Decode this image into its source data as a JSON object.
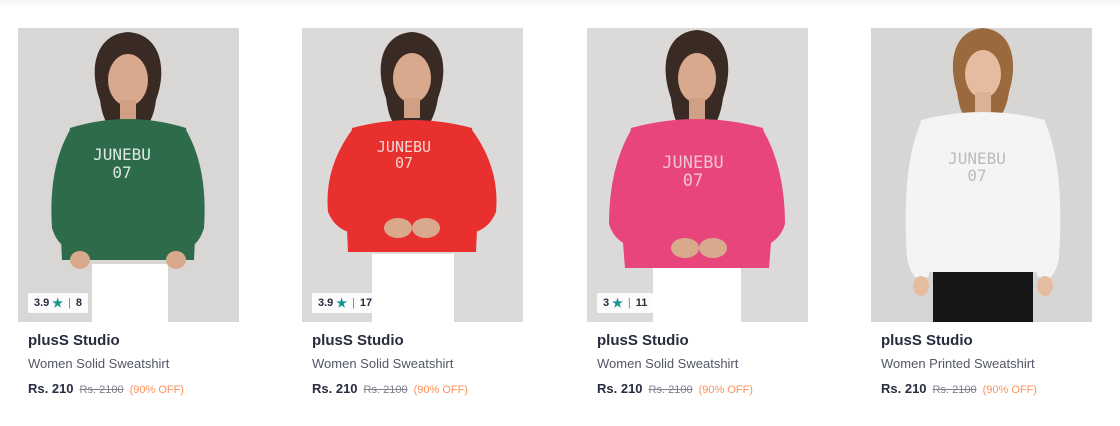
{
  "products": [
    {
      "brand": "plusS Studio",
      "title": "Women Solid Sweatshirt",
      "rating": "3.9",
      "rating_count": "8",
      "price": "Rs. 210",
      "mrp": "Rs. 2100",
      "discount": "(90% OFF)",
      "sweatshirt_color": "#2e6b4a",
      "print_line1": "JUNEBU",
      "print_line2": "07",
      "background": "#d9d7d6"
    },
    {
      "brand": "plusS Studio",
      "title": "Women Solid Sweatshirt",
      "rating": "3.9",
      "rating_count": "17",
      "price": "Rs. 210",
      "mrp": "Rs. 2100",
      "discount": "(90% OFF)",
      "sweatshirt_color": "#e8302f",
      "print_line1": "JUNEBU",
      "print_line2": "07",
      "background": "#dcdad9"
    },
    {
      "brand": "plusS Studio",
      "title": "Women Solid Sweatshirt",
      "rating": "3",
      "rating_count": "11",
      "price": "Rs. 210",
      "mrp": "Rs. 2100",
      "discount": "(90% OFF)",
      "sweatshirt_color": "#e8457d",
      "print_line1": "JUNEBU",
      "print_line2": "07",
      "background": "#dcdad9"
    },
    {
      "brand": "plusS Studio",
      "title": "Women Printed Sweatshirt",
      "rating": null,
      "rating_count": null,
      "price": "Rs. 210",
      "mrp": "Rs. 2100",
      "discount": "(90% OFF)",
      "sweatshirt_color": "#f4f4f4",
      "print_line1": "JUNEBU",
      "print_line2": "07",
      "background": "#d7d6d5"
    }
  ],
  "colors": {
    "rating_star": "#14958f",
    "discount": "#ff905a"
  }
}
